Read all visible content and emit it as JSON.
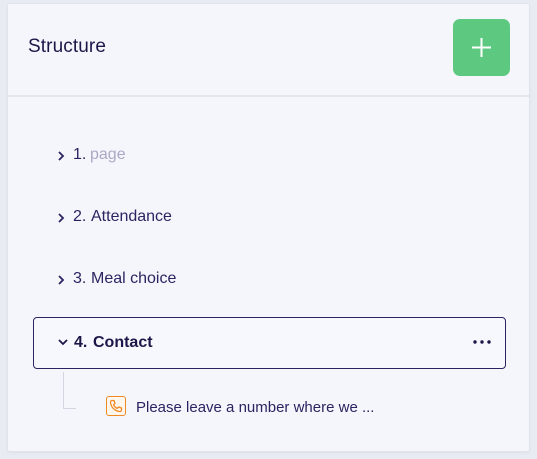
{
  "header": {
    "title": "Structure",
    "add_button_icon": "plus-icon",
    "add_button_color": "#5dc880"
  },
  "tree": {
    "items": [
      {
        "number": "1.",
        "label": "page",
        "expanded": false,
        "placeholder": true
      },
      {
        "number": "2.",
        "label": "Attendance",
        "expanded": false
      },
      {
        "number": "3.",
        "label": "Meal choice",
        "expanded": false
      },
      {
        "number": "4.",
        "label": "Contact",
        "expanded": true,
        "selected": true,
        "menu_icon": "more-horizontal-icon",
        "children": [
          {
            "icon": "phone-icon",
            "text": "Please leave a number where we ..."
          }
        ]
      }
    ]
  },
  "colors": {
    "text": "#2a2560",
    "muted": "#a8a9c4",
    "accent_orange": "#f08a24"
  }
}
